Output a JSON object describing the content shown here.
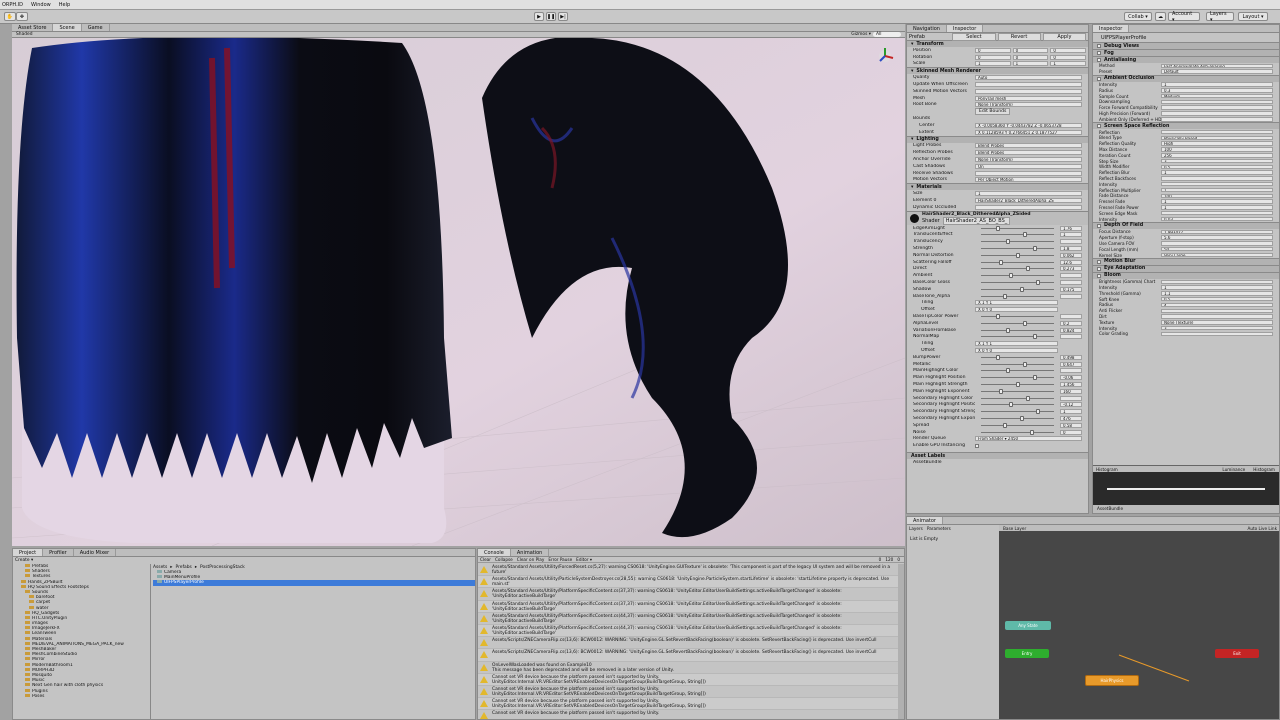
{
  "menubar": {
    "items": [
      "ORPH.ID",
      "Window",
      "Help"
    ]
  },
  "toolbar": {
    "play_controls": [
      "▶",
      "❚❚",
      "▶|"
    ],
    "collab": "Collab ▾",
    "cloud": "☁",
    "account": "Account ▾",
    "layers": "Layers ▾",
    "layout": "Layout ▾"
  },
  "scene": {
    "tabs": [
      "Asset Store",
      "Scene",
      "Game"
    ],
    "shading": "Shaded",
    "gizmos": "Gizmos ▾",
    "search": "All"
  },
  "navigation": {
    "tabs": [
      "Navigation",
      "Inspector"
    ],
    "prefab_bar": [
      "Prefab",
      "Select",
      "Revert",
      "Apply"
    ]
  },
  "transform": {
    "title": "Transform",
    "rows": [
      {
        "label": "Position",
        "x": "0",
        "y": "0",
        "z": "0"
      },
      {
        "label": "Rotation",
        "x": "0",
        "y": "0",
        "z": "0"
      },
      {
        "label": "Scale",
        "x": "1",
        "y": "1",
        "z": "1"
      }
    ]
  },
  "skinned_mesh": {
    "title": "Skinned Mesh Renderer",
    "rows": [
      {
        "label": "Quality",
        "value": "Auto"
      },
      {
        "label": "Update When Offscreen",
        "value": ""
      },
      {
        "label": "Skinned Motion Vectors",
        "value": ""
      },
      {
        "label": "Mesh",
        "value": "PonyTail mesh"
      },
      {
        "label": "Root Bone",
        "value": "None (Transform)"
      }
    ],
    "edit_bounds": "Edit Bounds",
    "bounds_label": "Bounds",
    "center_label": "Center",
    "center": "X -0.0058360  Y -0.0443782  Z -0.0653728",
    "extent_label": "Extent",
    "extent": "X 0.1128593  Y 0.2766451  Z 0.1877527"
  },
  "lighting": {
    "title": "Lighting",
    "rows": [
      {
        "label": "Light Probes",
        "value": "Blend Probes"
      },
      {
        "label": "Reflection Probes",
        "value": "Blend Probes"
      },
      {
        "label": "Anchor Override",
        "value": "None (Transform)"
      },
      {
        "label": "Cast Shadows",
        "value": "On"
      },
      {
        "label": "Receive Shadows",
        "value": ""
      },
      {
        "label": "Motion Vectors",
        "value": "Per Object Motion"
      }
    ]
  },
  "materials": {
    "title": "Materials",
    "rows": [
      {
        "label": "Size",
        "value": "1"
      },
      {
        "label": "Element 0",
        "value": "HairShader2_Black_DitheredAlpha_ZS"
      },
      {
        "label": "Dynamic Occluded",
        "value": ""
      }
    ]
  },
  "material": {
    "name": "HairShader2_Black_DitheredAlpha_ZSided",
    "shader_label": "Shader",
    "shader": "HairShader2_AS_BO_BS_",
    "rows": [
      {
        "label": "EdgeRimLight",
        "value": "1.76"
      },
      {
        "label": "TranslucentEffect",
        "value": "1"
      },
      {
        "label": "Translucency",
        "value": ""
      },
      {
        "label": "Strength",
        "value": "1.8"
      },
      {
        "label": "Normal Distortion",
        "value": "0.062"
      },
      {
        "label": "Scattering Falloff",
        "value": "12.6"
      },
      {
        "label": "Direct",
        "value": "0.273"
      },
      {
        "label": "Ambient",
        "value": ""
      },
      {
        "label": "BaseColor Gloss",
        "value": ""
      },
      {
        "label": "Shadow",
        "value": "0.175"
      },
      {
        "label": "BaseTone_Alpha",
        "value": ""
      }
    ],
    "tiling_label": "Tiling",
    "tiling": "X 1   Y 1",
    "offset_label": "Offset",
    "offset": "X 0   Y 0",
    "rows2": [
      {
        "label": "BaseTipColor Power",
        "value": ""
      },
      {
        "label": "AlphaLevel",
        "value": "0.2"
      },
      {
        "label": "VariationFromBase",
        "value": "0.824"
      },
      {
        "label": "NormalMap",
        "value": ""
      }
    ],
    "rows3": [
      {
        "label": "BumpPower",
        "value": "0.498"
      },
      {
        "label": "Metallic",
        "value": "0.647"
      },
      {
        "label": "MainHighlight Color",
        "value": ""
      },
      {
        "label": "Main Highlight Position",
        "value": "-0.06"
      },
      {
        "label": "Main Highlight Strength",
        "value": "1.456"
      },
      {
        "label": "Main Highlight Exponent",
        "value": "160"
      },
      {
        "label": "Secondary Highlight Color",
        "value": ""
      },
      {
        "label": "Secondary Highlight Position",
        "value": "-0.12"
      },
      {
        "label": "Secondary Highlight Strength",
        "value": "1"
      },
      {
        "label": "Secondary Highlight Exponent",
        "value": "476"
      },
      {
        "label": "Spread",
        "value": "0.58"
      },
      {
        "label": "Noise",
        "value": "0"
      }
    ],
    "render_queue_label": "Render Queue",
    "render_queue": "From Shader ▾  2450",
    "gpu_instancing": "Enable GPU Instancing",
    "asset_labels": "Asset Labels",
    "asset_bundle": "AssetBundle"
  },
  "animator": {
    "tabs": [
      "Animator"
    ],
    "subtabs": [
      "Layers",
      "Parameters"
    ],
    "base_layer": "Base Layer",
    "auto_live": "Auto Live Link",
    "list_empty": "List is Empty",
    "nodes": [
      "Any State",
      "Entry",
      "Exit",
      "HairPhysics"
    ]
  },
  "inspector2": {
    "tab": "Inspector",
    "title": "UIFPSPlayerProfile",
    "settings": [
      {
        "name": "Debug Views"
      },
      {
        "name": "Fog"
      },
      {
        "name": "Antialiasing",
        "rows": [
          {
            "label": "Method",
            "value": "Fast Approximate Anti-aliasing"
          },
          {
            "label": "Preset",
            "value": "Default"
          }
        ]
      },
      {
        "name": "Ambient Occlusion",
        "rows": [
          {
            "label": "Intensity",
            "value": "1"
          },
          {
            "label": "Radius",
            "value": "0.3"
          },
          {
            "label": "Sample Count",
            "value": "Medium"
          },
          {
            "label": "Downsampling",
            "value": ""
          },
          {
            "label": "Force Forward Compatibility",
            "value": ""
          },
          {
            "label": "High Precision (Forward)",
            "value": ""
          },
          {
            "label": "Ambient Only (Deferred + HDR)",
            "value": ""
          }
        ]
      },
      {
        "name": "Screen Space Reflection",
        "rows": [
          {
            "label": "Reflection",
            "value": ""
          },
          {
            "label": "Blend Type",
            "value": "Physically Based"
          },
          {
            "label": "Reflection Quality",
            "value": "High"
          },
          {
            "label": "Max Distance",
            "value": "100"
          },
          {
            "label": "Iteration Count",
            "value": "256"
          },
          {
            "label": "Step Size",
            "value": "3"
          },
          {
            "label": "Width Modifier",
            "value": "0.5"
          },
          {
            "label": "Reflection Blur",
            "value": "1"
          },
          {
            "label": "Reflect Backfaces",
            "value": ""
          },
          {
            "label": "Intensity",
            "value": ""
          },
          {
            "label": "Reflection Multiplier",
            "value": "1"
          },
          {
            "label": "Fade Distance",
            "value": "100"
          },
          {
            "label": "Fresnel Fade",
            "value": "1"
          },
          {
            "label": "Fresnel Fade Power",
            "value": "1"
          },
          {
            "label": "Screen Edge Mask",
            "value": ""
          },
          {
            "label": "Intensity",
            "value": "0.03"
          }
        ]
      },
      {
        "name": "Depth Of Field",
        "rows": [
          {
            "label": "Focus Distance",
            "value": "1.993427"
          },
          {
            "label": "Aperture (f-stop)",
            "value": "5.6"
          },
          {
            "label": "Use Camera FOV",
            "value": ""
          },
          {
            "label": "Focal Length (mm)",
            "value": "50"
          },
          {
            "label": "Kernel Size",
            "value": "Very Large"
          }
        ]
      },
      {
        "name": "Motion Blur"
      },
      {
        "name": "Eye Adaptation"
      },
      {
        "name": "Bloom",
        "rows": [
          {
            "label": "Brightness (Gamma) Chart",
            "value": ""
          },
          {
            "label": "Intensity",
            "value": "1"
          },
          {
            "label": "Threshold (Gamma)",
            "value": "1.1"
          },
          {
            "label": "Soft Knee",
            "value": "0.5"
          },
          {
            "label": "Radius",
            "value": "4"
          },
          {
            "label": "Anti Flicker",
            "value": ""
          },
          {
            "label": "Dirt",
            "value": ""
          },
          {
            "label": "Texture",
            "value": "None (Texture)"
          },
          {
            "label": "Intensity",
            "value": "3"
          },
          {
            "label": "Color Grading",
            "value": ""
          }
        ]
      }
    ],
    "histogram_tabs": [
      "Histogram",
      "Luminance",
      "Histogram"
    ],
    "asset_bundle": "AssetBundle"
  },
  "project": {
    "tabs": [
      "Project",
      "Profiler",
      "Audio Mixer"
    ],
    "create": "Create ▾",
    "tree": [
      "Prefabs",
      "Shaders",
      "Textures",
      "Hands_ZPSBuilt",
      "HQ Sound Effects Footsteps",
      "Sounds",
      "barefoot",
      "carpet",
      "water",
      "HQ_Gadgets",
      "HTC.UnityPlugin",
      "images",
      "ImageJerkFX",
      "LeanTween",
      "Materials",
      "MEDIEVAL_ANIMATIONS_MEGA_PACK_new",
      "MeshBaker",
      "MeshCombineStudio",
      "Mirror",
      "ModernBathroom1",
      "MORPH3D",
      "Mosquito",
      "Music",
      "Next Gen hair with cloth physics",
      "Plugins",
      "Poses"
    ],
    "breadcrumb": [
      "Assets",
      "Prefabs",
      "PostProcessingStack"
    ],
    "files": [
      "Camera",
      "MainMenuProfile",
      "UIFPSPlayerProfile"
    ]
  },
  "console": {
    "tabs": [
      "Console",
      "Animation"
    ],
    "buttons": [
      "Clear",
      "Collapse",
      "Clear on Play",
      "Error Pause",
      "Editor ▾"
    ],
    "counts": [
      "0",
      "120",
      "0"
    ],
    "messages": [
      "Assets/Standard Assets/Utility/ForcedReset.cs(5,27): warning CS0618: 'UnityEngine.GUITexture' is obsolete: 'This component is part of the legacy UI system and will be removed in a future'",
      "Assets/Standard Assets/Utility/ParticleSystemDestroyer.cs(28,55): warning CS0618: 'UnityEngine.ParticleSystem.startLifetime' is obsolete: 'startLifetime property is deprecated. Use main.st'",
      "Assets/Standard Assets/Utility/PlatformSpecificContent.cs(37,37): warning CS0618: 'UnityEditor.EditorUserBuildSettings.activeBuildTargetChanged' is obsolete: 'UnityEditor.activeBuildTarge'",
      "Assets/Standard Assets/Utility/PlatformSpecificContent.cs(37,37): warning CS0618: 'UnityEditor.EditorUserBuildSettings.activeBuildTargetChanged' is obsolete: 'UnityEditor.activeBuildTarge'",
      "Assets/Standard Assets/Utility/PlatformSpecificContent.cs(44,37): warning CS0618: 'UnityEditor.EditorUserBuildSettings.activeBuildTargetChanged' is obsolete: 'UnityEditor.activeBuildTarge'",
      "Assets/Standard Assets/Utility/PlatformSpecificContent.cs(44,37): warning CS0618: 'UnityEditor.EditorUserBuildSettings.activeBuildTargetChanged' is obsolete: 'UnityEditor.activeBuildTarge'",
      "Assets/Scripts/ZNECameraFlip.cs(13,6): BCW0012: WARNING: 'UnityEngine.GL.SetRevertBackFacing(boolean)' is obsolete. SetRevertBackFacing() is deprecated. Use invertCull",
      "Assets/Scripts/ZNECameraFlip.cs(13,6): BCW0012: WARNING: 'UnityEngine.GL.SetRevertBackFacing(boolean)' is obsolete. SetRevertBackFacing() is deprecated. Use invertCull",
      "OnLevelWasLoaded was found on Example10\nThis message has been deprecated and will be removed in a later version of Unity.",
      "Cannot set VR device because the platform passed isn't supported by Unity.\nUnityEditor.Internal.VR.VREditor:SetVREnabledDevicesOnTargetGroup(BuildTargetGroup, String[])",
      "Cannot set VR device because the platform passed isn't supported by Unity.\nUnityEditor.Internal.VR.VREditor:SetVREnabledDevicesOnTargetGroup(BuildTargetGroup, String[])",
      "Cannot set VR device because the platform passed isn't supported by Unity.\nUnityEditor.Internal.VR.VREditor:SetVREnabledDevicesOnTargetGroup(BuildTargetGroup, String[])",
      "Cannot set VR device because the platform passed isn't supported by Unity."
    ]
  },
  "colors": {
    "selection": "#3d7bd9",
    "any_state": "#5fb9a8",
    "entry": "#2eae2e",
    "exit": "#c42424",
    "state": "#e89a2a"
  }
}
